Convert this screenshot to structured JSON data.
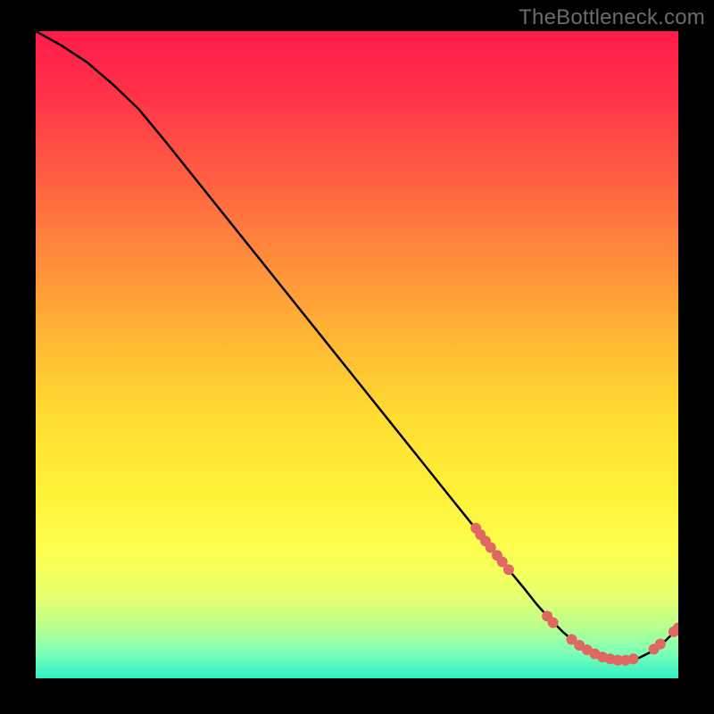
{
  "watermark": "TheBottleneck.com",
  "chart_data": {
    "type": "line",
    "title": "",
    "xlabel": "",
    "ylabel": "",
    "xlim": [
      0,
      100
    ],
    "ylim": [
      0,
      100
    ],
    "grid": false,
    "legend": false,
    "series": [
      {
        "name": "bottleneck-curve",
        "x": [
          0,
          4,
          8,
          12,
          16,
          20,
          25,
          30,
          35,
          40,
          45,
          50,
          55,
          60,
          65,
          68,
          70,
          72,
          74,
          76,
          78,
          80,
          82,
          84,
          86,
          88,
          90,
          92,
          94,
          96,
          98,
          100
        ],
        "y": [
          100,
          97.8,
          95.2,
          91.8,
          88.0,
          83.2,
          77.0,
          70.8,
          64.6,
          58.4,
          52.2,
          46.0,
          39.8,
          33.6,
          27.4,
          23.7,
          21.2,
          18.8,
          16.3,
          13.9,
          11.4,
          9.2,
          7.2,
          5.5,
          4.2,
          3.2,
          2.7,
          2.7,
          3.2,
          4.2,
          5.8,
          7.8
        ]
      }
    ],
    "dot_clusters": [
      {
        "name": "upper-slope",
        "points": [
          {
            "x": 68.5,
            "y": 23.2
          },
          {
            "x": 69.2,
            "y": 22.2
          },
          {
            "x": 70.0,
            "y": 21.2
          },
          {
            "x": 70.8,
            "y": 20.2
          },
          {
            "x": 71.8,
            "y": 19.0
          },
          {
            "x": 72.6,
            "y": 18.0
          },
          {
            "x": 73.6,
            "y": 16.8
          }
        ]
      },
      {
        "name": "valley-left",
        "points": [
          {
            "x": 79.6,
            "y": 9.6
          },
          {
            "x": 80.5,
            "y": 8.6
          }
        ]
      },
      {
        "name": "valley-bottom",
        "points": [
          {
            "x": 83.4,
            "y": 6.0
          },
          {
            "x": 84.6,
            "y": 5.1
          },
          {
            "x": 85.8,
            "y": 4.4
          },
          {
            "x": 87.0,
            "y": 3.8
          },
          {
            "x": 88.2,
            "y": 3.3
          },
          {
            "x": 89.4,
            "y": 3.0
          },
          {
            "x": 90.6,
            "y": 2.8
          },
          {
            "x": 91.8,
            "y": 2.8
          },
          {
            "x": 93.0,
            "y": 3.0
          }
        ]
      },
      {
        "name": "valley-right",
        "points": [
          {
            "x": 96.2,
            "y": 4.5
          },
          {
            "x": 97.2,
            "y": 5.3
          }
        ]
      },
      {
        "name": "tail",
        "points": [
          {
            "x": 99.3,
            "y": 7.2
          },
          {
            "x": 100.0,
            "y": 7.8
          }
        ]
      }
    ],
    "gradient_stops": [
      {
        "pos": 0.0,
        "color": "#ff1b4a"
      },
      {
        "pos": 0.09,
        "color": "#ff3049"
      },
      {
        "pos": 0.2,
        "color": "#ff5544"
      },
      {
        "pos": 0.3,
        "color": "#ff7a3e"
      },
      {
        "pos": 0.4,
        "color": "#ff9d38"
      },
      {
        "pos": 0.5,
        "color": "#ffbf33"
      },
      {
        "pos": 0.6,
        "color": "#ffdd31"
      },
      {
        "pos": 0.72,
        "color": "#fff239"
      },
      {
        "pos": 0.8,
        "color": "#fdff4e"
      },
      {
        "pos": 0.87,
        "color": "#e9ff6c"
      },
      {
        "pos": 0.92,
        "color": "#baff8e"
      },
      {
        "pos": 0.96,
        "color": "#7effb6"
      },
      {
        "pos": 1.0,
        "color": "#30efc5"
      }
    ],
    "colors": {
      "curve": "#000000",
      "dots": "#e06862",
      "watermark": "#6b6b6b",
      "background": "#000000"
    }
  }
}
